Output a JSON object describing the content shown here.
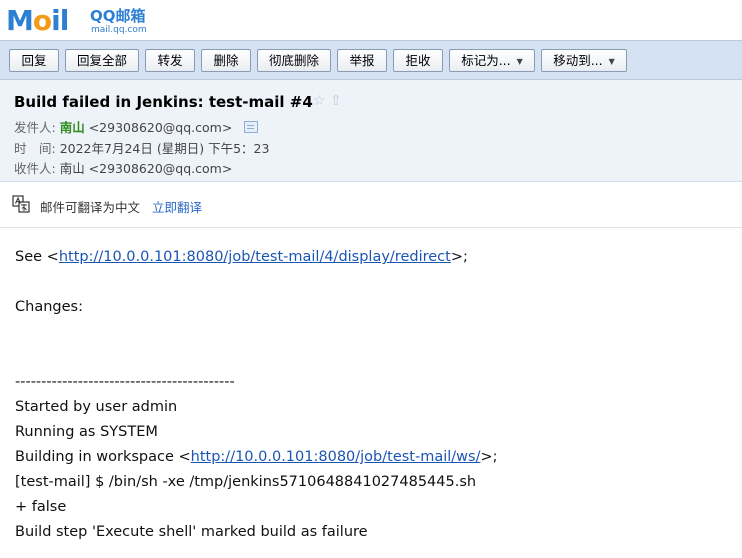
{
  "logo": {
    "mail_text_1": "M",
    "mail_text_2": "o",
    "mail_text_3": "il",
    "qq_text": "QQ邮箱",
    "domain_text": "mail.qq.com"
  },
  "toolbar": {
    "buttons": [
      {
        "label": "回复"
      },
      {
        "label": "回复全部"
      },
      {
        "label": "转发"
      },
      {
        "label": "删除"
      },
      {
        "label": "彻底删除"
      },
      {
        "label": "举报"
      },
      {
        "label": "拒收"
      },
      {
        "label": "标记为..."
      },
      {
        "label": "移动到..."
      }
    ],
    "dropdown_arrow": "▼"
  },
  "header": {
    "subject": "Build failed in Jenkins: test-mail #4",
    "stars": "☆ ⇧",
    "from_label": "发件人:",
    "from_name": "南山",
    "from_email": "<29308620@qq.com>",
    "time_label": "时　间:",
    "time_value": "2022年7月24日 (星期日) 下午5：23",
    "to_label": "收件人:",
    "to_value": "南山 <29308620@qq.com>"
  },
  "translate": {
    "text": "邮件可翻译为中文",
    "link": "立即翻译"
  },
  "body": {
    "see_prefix": "See <",
    "see_link": "http://10.0.0.101:8080/job/test-mail/4/display/redirect",
    "see_suffix": ">;",
    "changes": "Changes:",
    "divider": "------------------------------------------",
    "started": "Started by user admin",
    "running": "Running as SYSTEM",
    "building_prefix": "Building in workspace <",
    "building_link": "http://10.0.0.101:8080/job/test-mail/ws/",
    "building_suffix": ">;",
    "shell_cmd": "[test-mail] $ /bin/sh -xe /tmp/jenkins5710648841027485445.sh",
    "false_line": "+ false",
    "build_step": "Build step 'Execute shell' marked build as failure"
  }
}
